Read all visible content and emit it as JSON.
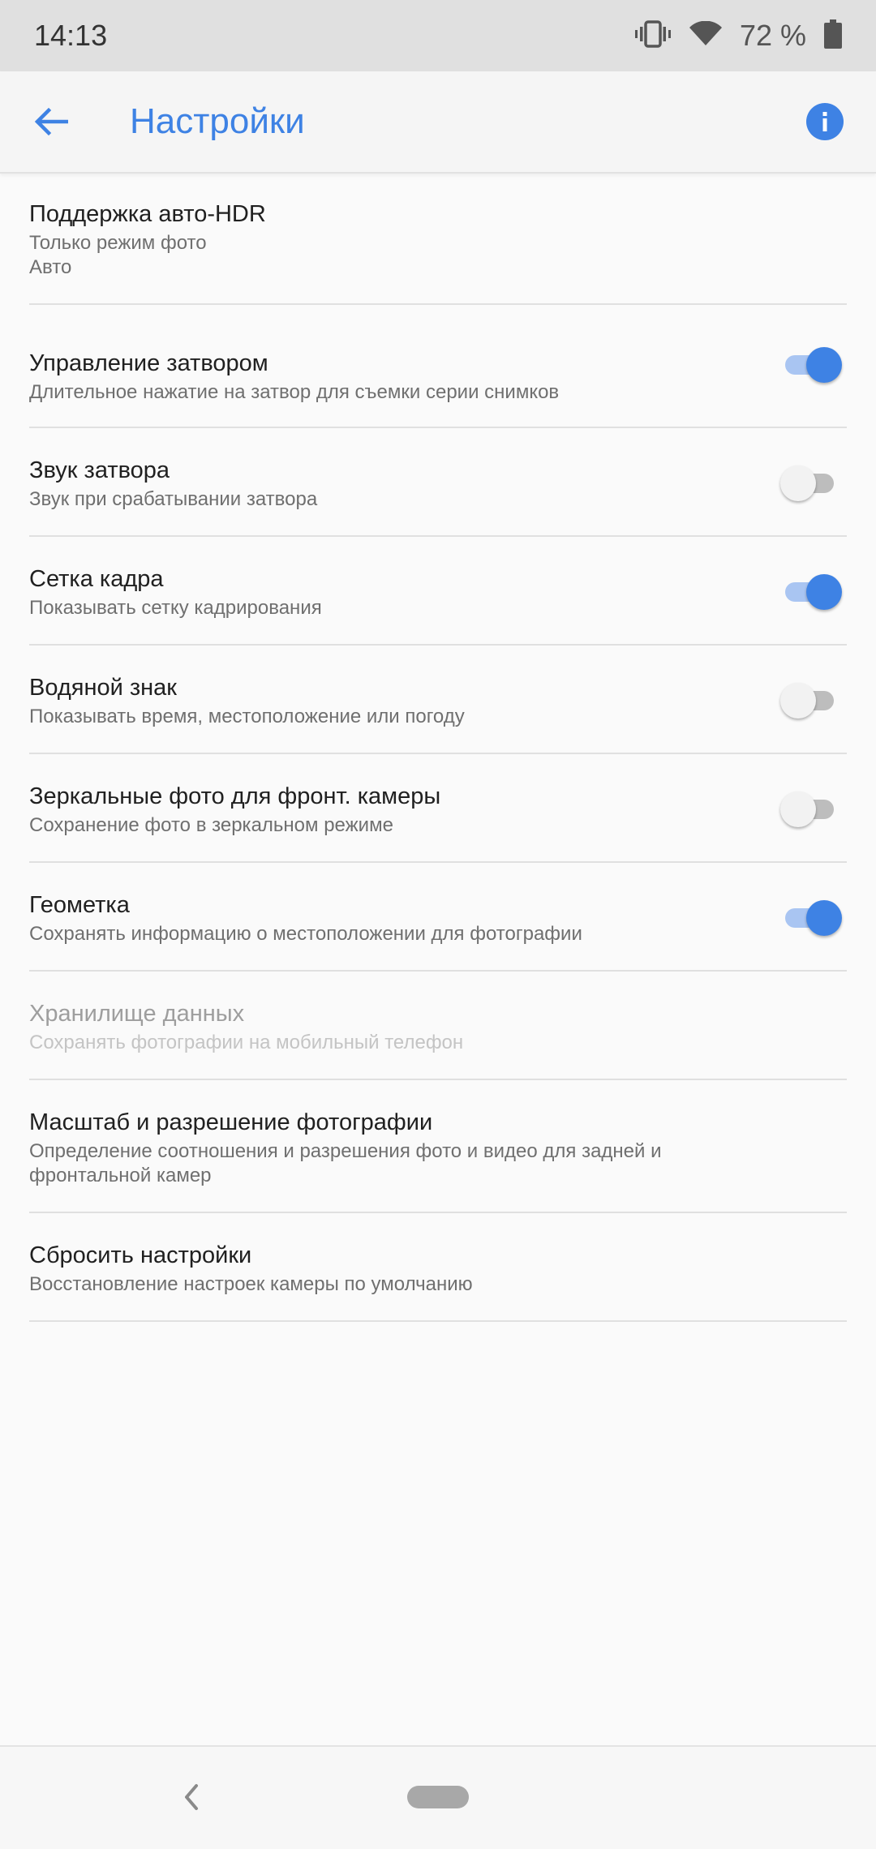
{
  "status": {
    "time": "14:13",
    "battery_pct": "72 %",
    "icons": [
      "vibrate-icon",
      "wifi-icon",
      "battery-icon"
    ]
  },
  "appbar": {
    "title": "Настройки",
    "back_icon": "arrow-left-icon",
    "info_icon": "info-icon",
    "accent_color": "#3e82e4"
  },
  "settings": [
    {
      "title": "Поддержка авто-HDR",
      "sub": "Только режим фото",
      "sub2": "Авто"
    },
    {
      "title": "Управление затвором",
      "sub": "Длительное нажатие на затвор для съемки серии снимков",
      "toggle": true
    },
    {
      "title": "Звук затвора",
      "sub": "Звук при срабатывании затвора",
      "toggle": false
    },
    {
      "title": "Сетка кадра",
      "sub": "Показывать сетку кадрирования",
      "toggle": true
    },
    {
      "title": "Водяной знак",
      "sub": "Показывать время, местоположение или погоду",
      "toggle": false
    },
    {
      "title": "Зеркальные фото для фронт. камеры",
      "sub": "Сохранение фото в зеркальном режиме",
      "toggle": false
    },
    {
      "title": "Геометка",
      "sub": "Сохранять информацию о местоположении для фотографии",
      "toggle": true
    },
    {
      "title": "Хранилище данных",
      "sub": "Сохранять фотографии на мобильный телефон",
      "disabled": true
    },
    {
      "title": "Масштаб и разрешение фотографии",
      "sub": "Определение соотношения и разрешения фото и видео для задней и фронтальной камер"
    },
    {
      "title": "Сбросить настройки",
      "sub": "Восстановление настроек камеры по умолчанию"
    }
  ],
  "navbar": {
    "icons": [
      "nav-back-icon",
      "home-pill-icon"
    ]
  }
}
